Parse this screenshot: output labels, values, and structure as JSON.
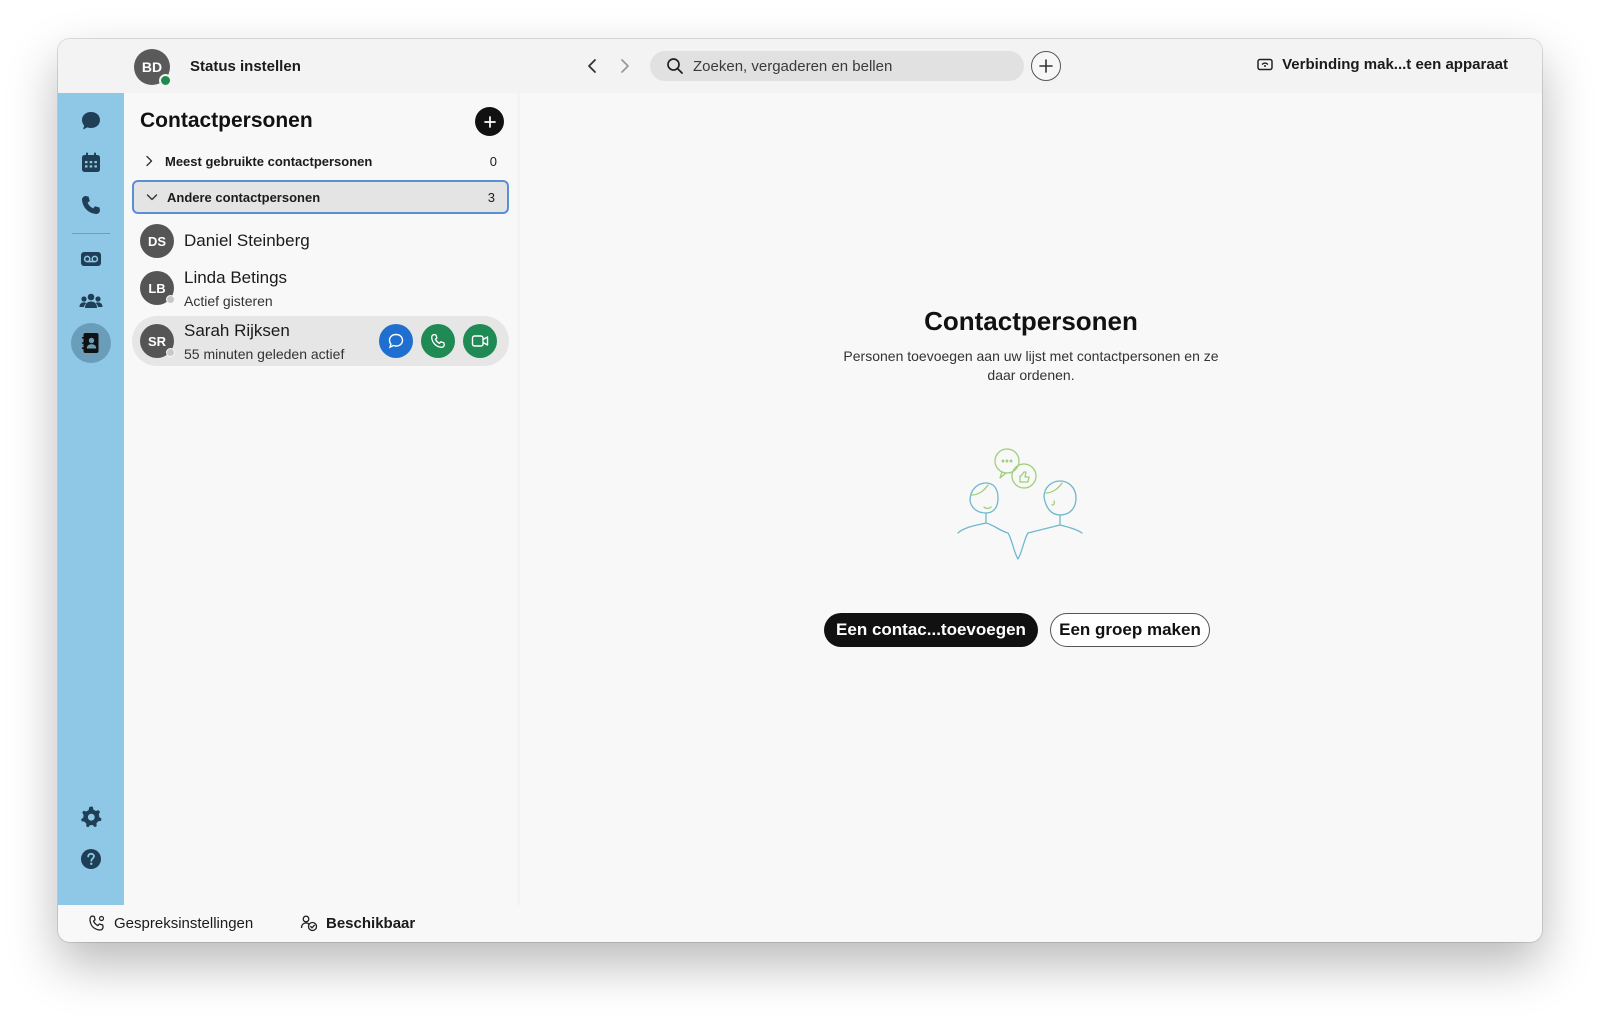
{
  "titlebar": {
    "avatar_initials": "BD",
    "status_label": "Status instellen",
    "search_placeholder": "Zoeken, vergaderen en bellen",
    "connect_label": "Verbinding mak...t een apparaat"
  },
  "rail": {
    "items": [
      {
        "name": "messaging",
        "icon": "chat-bubble-icon",
        "active": false
      },
      {
        "name": "calendar",
        "icon": "calendar-icon",
        "active": false
      },
      {
        "name": "calling",
        "icon": "phone-icon",
        "active": false
      },
      {
        "name": "voicemail",
        "icon": "voicemail-icon",
        "active": false
      },
      {
        "name": "teams",
        "icon": "people-icon",
        "active": false
      },
      {
        "name": "contacts",
        "icon": "contacts-book-icon",
        "active": true
      }
    ],
    "bottom": [
      {
        "name": "settings",
        "icon": "gear-icon"
      },
      {
        "name": "help",
        "icon": "help-icon"
      }
    ],
    "color": "#8fc8e6"
  },
  "contacts": {
    "title": "Contactpersonen",
    "groups": [
      {
        "label": "Meest gebruikte contactpersonen",
        "count": "0",
        "expanded": false
      },
      {
        "label": "Andere contactpersonen",
        "count": "3",
        "expanded": true
      }
    ],
    "people": [
      {
        "initials": "DS",
        "name": "Daniel Steinberg",
        "status": ""
      },
      {
        "initials": "LB",
        "name": "Linda Betings",
        "status": "Actief gisteren"
      },
      {
        "initials": "SR",
        "name": "Sarah Rijksen",
        "status": "55 minuten geleden actief"
      }
    ]
  },
  "main": {
    "title": "Contactpersonen",
    "description": "Personen toevoegen aan uw lijst met contactpersonen en ze daar ordenen.",
    "primary_button": "Een contac...toevoegen",
    "secondary_button": "Een groep maken"
  },
  "footer": {
    "call_settings": "Gespreksinstellingen",
    "availability": "Beschikbaar"
  }
}
